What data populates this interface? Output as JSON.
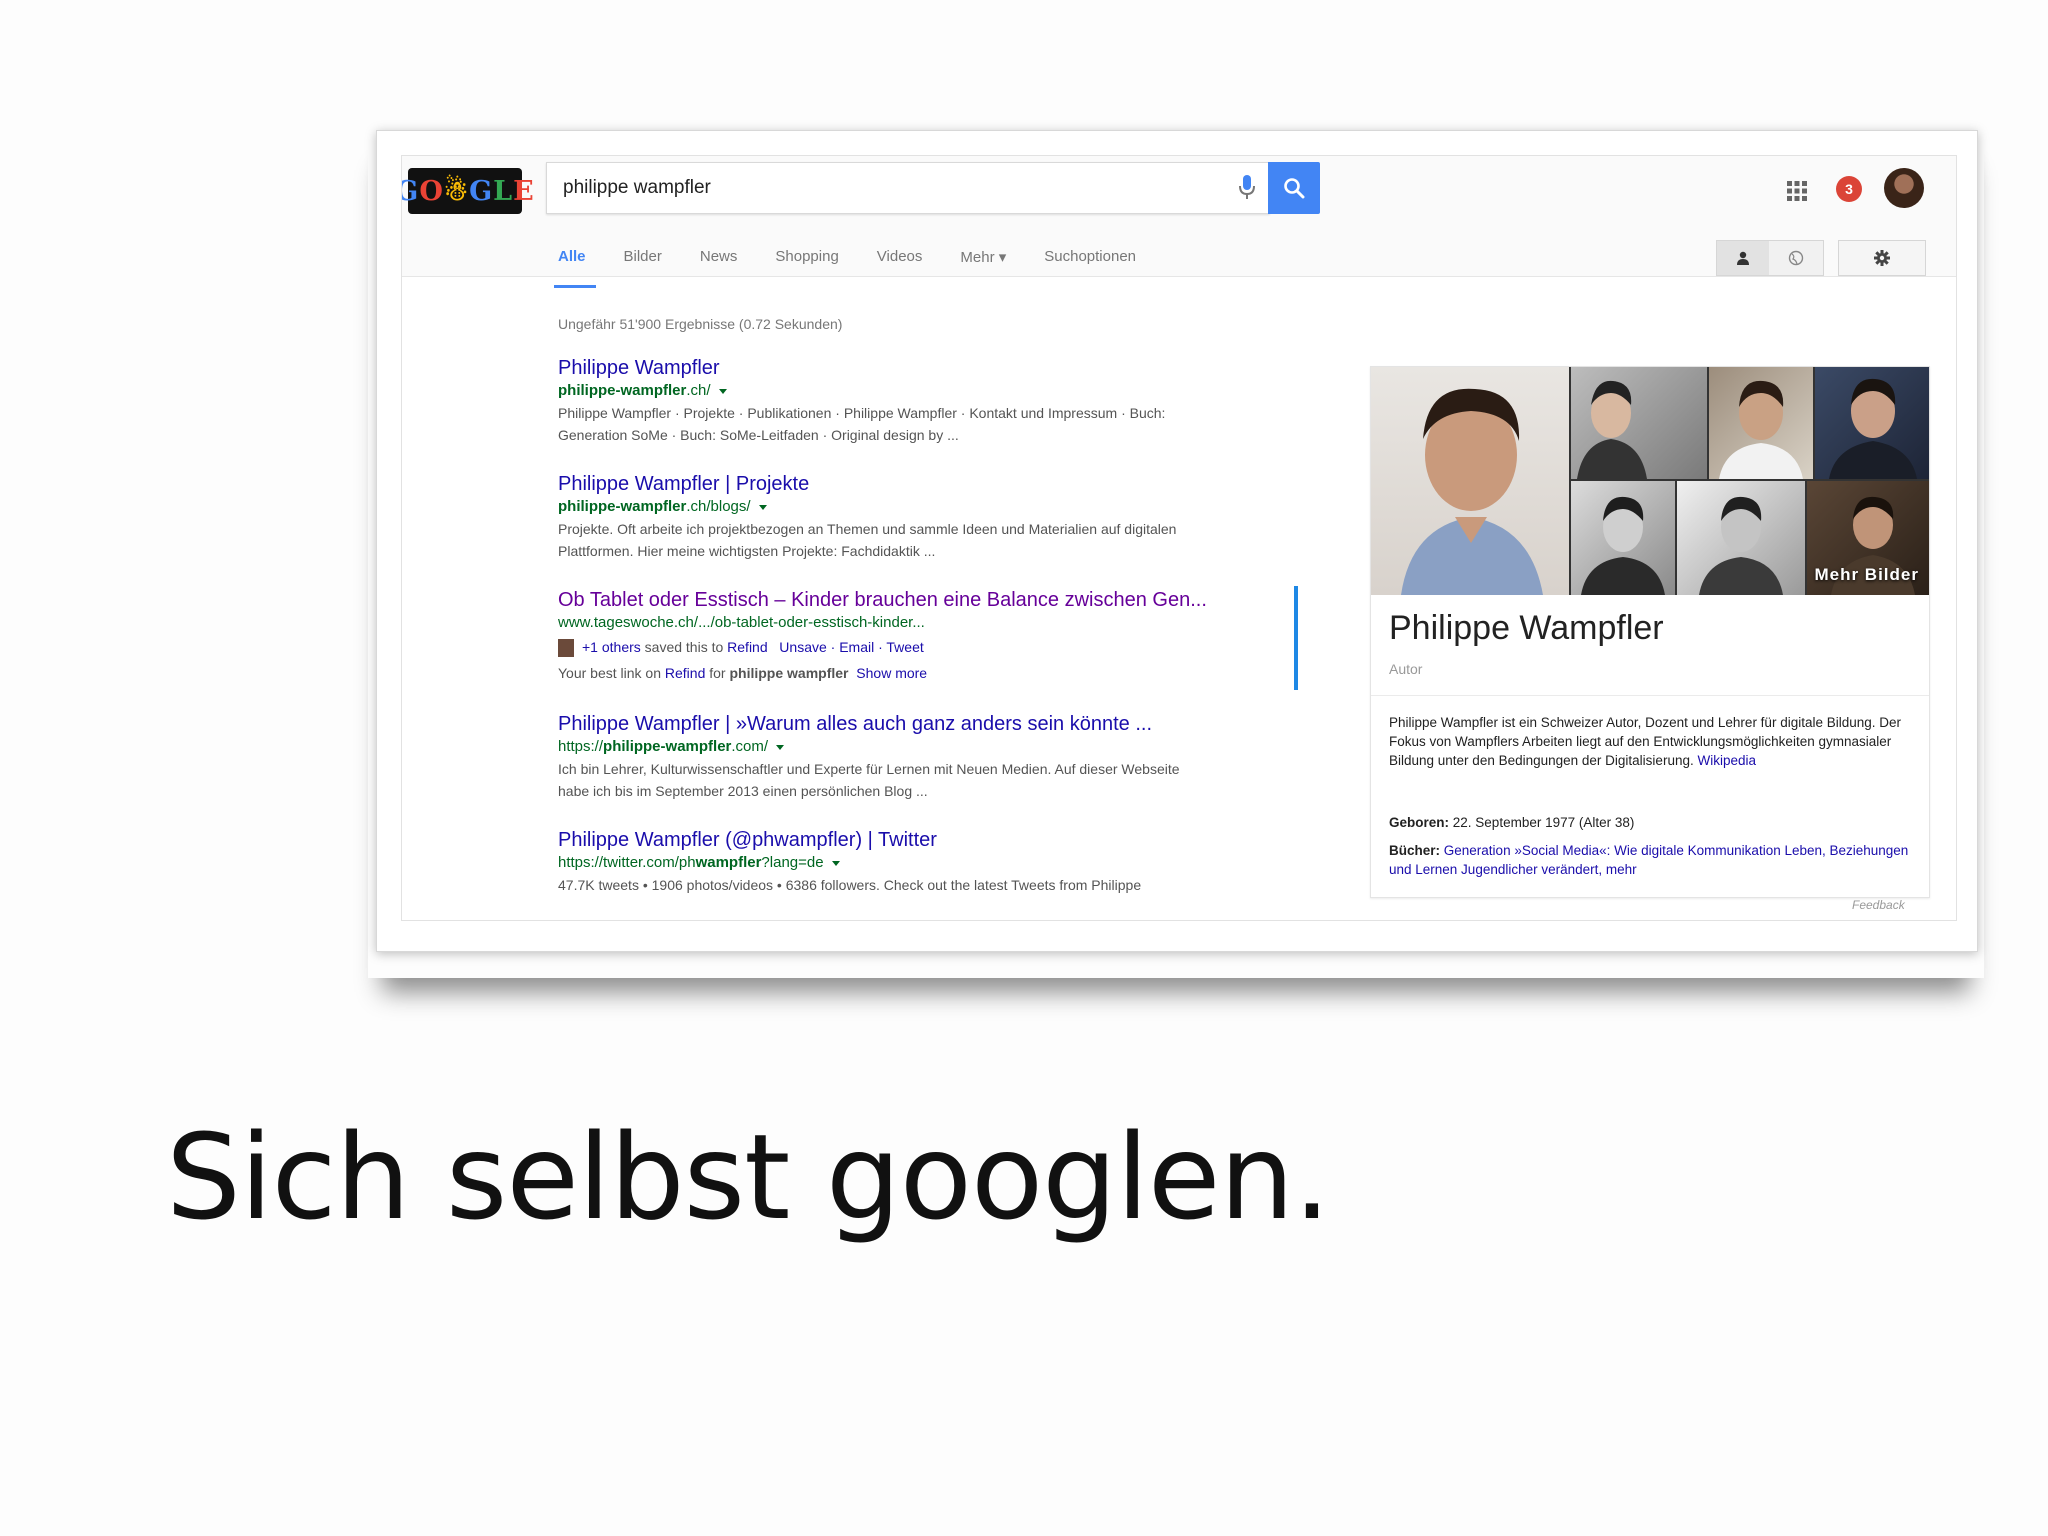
{
  "logo": {
    "letters": [
      "GO",
      "O",
      "GLE"
    ]
  },
  "search": {
    "query": "philippe wampfler"
  },
  "header": {
    "notification_count": "3"
  },
  "tabs": [
    {
      "label": "Alle",
      "active": true
    },
    {
      "label": "Bilder"
    },
    {
      "label": "News"
    },
    {
      "label": "Shopping"
    },
    {
      "label": "Videos"
    },
    {
      "label": "Mehr ▾"
    },
    {
      "label": "Suchoptionen"
    }
  ],
  "stats": "Ungefähr 51'900 Ergebnisse (0.72 Sekunden)",
  "results": [
    {
      "title": "Philippe Wampfler",
      "url_bold": "philippe-wampfler",
      "url_rest": ".ch/",
      "snippet_1": "Philippe Wampfler · Projekte · Publikationen · Philippe Wampfler · Kontakt und Impressum · Buch:",
      "snippet_2": "Generation SoMe · Buch: SoMe-Leitfaden · Original design by ..."
    },
    {
      "title": "Philippe Wampfler | Projekte",
      "url_bold": "philippe-wampfler",
      "url_rest": ".ch/blogs/",
      "snippet_1": "Projekte. Oft arbeite ich projektbezogen an Themen und sammle Ideen und Materialien auf digitalen",
      "snippet_2": "Plattformen. Hier meine wichtigsten Projekte: Fachdidaktik ..."
    },
    {
      "title": "Ob Tablet oder Esstisch – Kinder brauchen eine Balance zwischen Gen...",
      "url_plain": "www.tageswoche.ch/.../ob-tablet-oder-esstisch-kinder...",
      "refind_saved_count": "+1 others",
      "refind_saved_text": "saved this to",
      "refind_name": "Refind",
      "refind_actions": "Unsave · Email · Tweet",
      "refind_best_prefix": "Your best link on",
      "refind_best_for": "for",
      "refind_best_query": "philippe wampfler",
      "refind_show_more": "Show more"
    },
    {
      "title": "Philippe Wampfler | »Warum alles auch ganz anders sein könnte ...",
      "url_prefix": "https://",
      "url_bold": "philippe-wampfler",
      "url_rest": ".com/",
      "snippet_1": "Ich bin Lehrer, Kulturwissenschaftler und Experte für Lernen mit Neuen Medien. Auf dieser Webseite",
      "snippet_2": "habe ich bis im September 2013 einen persönlichen Blog ..."
    },
    {
      "title": "Philippe Wampfler (@phwampfler) | Twitter",
      "url_prefix": "https://twitter.com/ph",
      "url_bold": "wampfler",
      "url_rest": "?lang=de",
      "snippet_1": "47.7K tweets • 1906 photos/videos • 6386 followers. Check out the latest Tweets from Philippe"
    }
  ],
  "knowledge_panel": {
    "more_images": "Mehr Bilder",
    "name": "Philippe Wampfler",
    "type": "Autor",
    "description": "Philippe Wampfler ist ein Schweizer Autor, Dozent und Lehrer für digitale Bildung. Der Fokus von Wampflers Arbeiten liegt auf den Entwicklungsmöglichkeiten gymnasialer Bildung unter den Bedingungen der Digitalisierung.",
    "description_source": "Wikipedia",
    "born_label": "Geboren:",
    "born_value": "22. September 1977 (Alter 38)",
    "books_label": "Bücher:",
    "books_value": "Generation »Social Media«: Wie digitale Kommunikation Leben, Beziehungen und Lernen Jugendlicher verändert,",
    "books_more": "mehr",
    "feedback": "Feedback"
  },
  "caption": "Sich selbst googlen.",
  "colors": {
    "link": "#1a0dab",
    "visited": "#660099",
    "url_green": "#006621",
    "accent_blue": "#4285f4",
    "notification_red": "#db4437"
  }
}
